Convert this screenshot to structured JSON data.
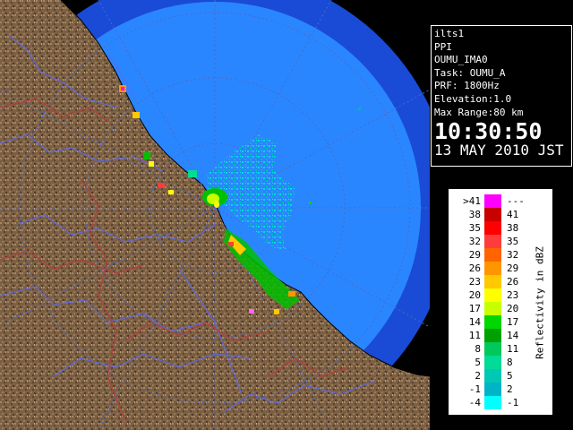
{
  "info": {
    "site": "ilts1",
    "product": "PPI",
    "radar_id": "OUMU_IMA0",
    "task": "Task: OUMU_A",
    "prf": "PRF: 1800Hz",
    "elevation": "Elevation:1.0",
    "max_range": "Max Range:80 km",
    "time": "10:30:50",
    "date": "13 MAY 2010 JST"
  },
  "legend": {
    "title": "Reflectivity in dBZ",
    "rows": [
      {
        "lo": ">41",
        "hi": "---",
        "color": "#ff00ff"
      },
      {
        "lo": "38",
        "hi": "41",
        "color": "#c80000"
      },
      {
        "lo": "35",
        "hi": "38",
        "color": "#ff0000"
      },
      {
        "lo": "32",
        "hi": "35",
        "color": "#ff3c3c"
      },
      {
        "lo": "29",
        "hi": "32",
        "color": "#ff6400"
      },
      {
        "lo": "26",
        "hi": "29",
        "color": "#ff9600"
      },
      {
        "lo": "23",
        "hi": "26",
        "color": "#ffc800"
      },
      {
        "lo": "20",
        "hi": "23",
        "color": "#ffff00"
      },
      {
        "lo": "17",
        "hi": "20",
        "color": "#c8ff00"
      },
      {
        "lo": "14",
        "hi": "17",
        "color": "#00d700"
      },
      {
        "lo": "11",
        "hi": "14",
        "color": "#00a000"
      },
      {
        "lo": "8",
        "hi": "11",
        "color": "#00c85a"
      },
      {
        "lo": "5",
        "hi": "8",
        "color": "#00dc96"
      },
      {
        "lo": "2",
        "hi": "5",
        "color": "#00c8b4"
      },
      {
        "lo": "-1",
        "hi": "2",
        "color": "#00b4c8"
      },
      {
        "lo": "-4",
        "hi": "-1",
        "color": "#00ffff"
      }
    ]
  },
  "colors": {
    "background": "#000000",
    "outer_range": "#1a4bd6",
    "inner_range": "#2a86ff",
    "outer_field": "#0000ff",
    "terrain": "#8a6a48",
    "range_ring": "#4a6ac8",
    "river": "#5a6af0",
    "border": "#b04040"
  }
}
